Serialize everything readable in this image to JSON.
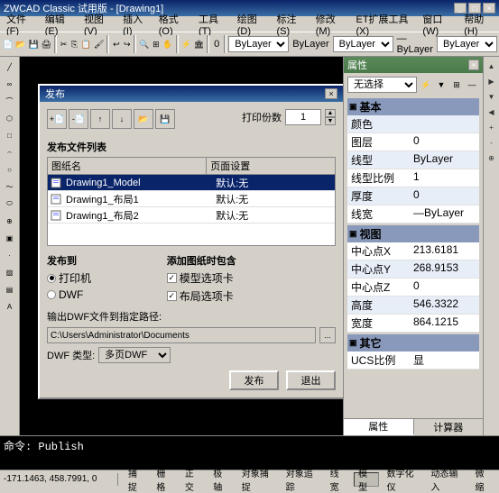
{
  "titleBar": {
    "text": "ZWCAD Classic 试用版 - [Drawing1]",
    "controls": [
      "_",
      "□",
      "×"
    ]
  },
  "menuBar": {
    "items": [
      "文件(F)",
      "编辑(E)",
      "视图(V)",
      "插入(I)",
      "格式(O)",
      "工具(T)",
      "绘图(D)",
      "标注(S)",
      "修改(M)",
      "ET扩展工具(X)",
      "窗口(W)",
      "帮助(H)"
    ]
  },
  "toolbar": {
    "bylayer_label": "ByLayer",
    "layer_label": "— ByLayer",
    "linetype_label": "— ByLayer"
  },
  "dialog": {
    "title": "发布",
    "close_btn": "×",
    "print_copies_label": "打印份数",
    "print_copies_value": "1",
    "file_list_title": "发布文件列表",
    "columns": [
      "图纸名",
      "页面设置"
    ],
    "files": [
      {
        "name": "Drawing1_Model",
        "setting": "默认:无",
        "selected": true
      },
      {
        "name": "Drawing1_布局1",
        "setting": "默认:无",
        "selected": false
      },
      {
        "name": "Drawing1_布局2",
        "setting": "默认:无",
        "selected": false
      }
    ],
    "publish_to": {
      "label": "发布到",
      "options": [
        {
          "label": "打印机",
          "selected": true
        },
        {
          "label": "DWF",
          "selected": false
        }
      ]
    },
    "add_tabs": {
      "label": "添加图纸时包含",
      "options": [
        {
          "label": "模型选项卡",
          "checked": true
        },
        {
          "label": "布局选项卡",
          "checked": true
        }
      ]
    },
    "output_path": {
      "label": "输出DWF文件到指定路径:",
      "value": "C:\\Users\\Administrator\\Documents"
    },
    "dwf_type": {
      "label": "DWF 类型:",
      "value": "多页DWF"
    },
    "buttons": {
      "publish": "发布",
      "exit": "退出"
    }
  },
  "rightPanel": {
    "title": "属性",
    "no_select_label": "无选择",
    "icons": [
      "⚡",
      "▼",
      "⊞",
      "—"
    ],
    "tabs": [
      "属性",
      "计算器"
    ],
    "categories": [
      {
        "name": "基本",
        "rows": [
          {
            "key": "颜色",
            "val": ""
          },
          {
            "key": "图层",
            "val": "0"
          },
          {
            "key": "线型",
            "val": "ByLayer"
          },
          {
            "key": "线型比例",
            "val": "1"
          },
          {
            "key": "厚度",
            "val": "0"
          },
          {
            "key": "线宽",
            "val": "—ByLayer"
          }
        ]
      },
      {
        "name": "视图",
        "rows": [
          {
            "key": "中心点X",
            "val": "213.6181"
          },
          {
            "key": "中心点Y",
            "val": "268.9153"
          },
          {
            "key": "中心点Z",
            "val": "0"
          },
          {
            "key": "高度",
            "val": "546.3322"
          },
          {
            "key": "宽度",
            "val": "864.1215"
          }
        ]
      },
      {
        "name": "其它",
        "rows": [
          {
            "key": "UCS比例",
            "val": "显"
          }
        ]
      }
    ]
  },
  "commandLine": {
    "prompt": "命令: Publish"
  },
  "statusBar": {
    "coords": "-171.1463, 458.7991, 0",
    "items": [
      "捕捉",
      "栅格",
      "正交",
      "极轴",
      "对象捕捉",
      "对象追踪",
      "线宽",
      "模型",
      "数字化仪",
      "动态输入",
      "微缩"
    ]
  }
}
